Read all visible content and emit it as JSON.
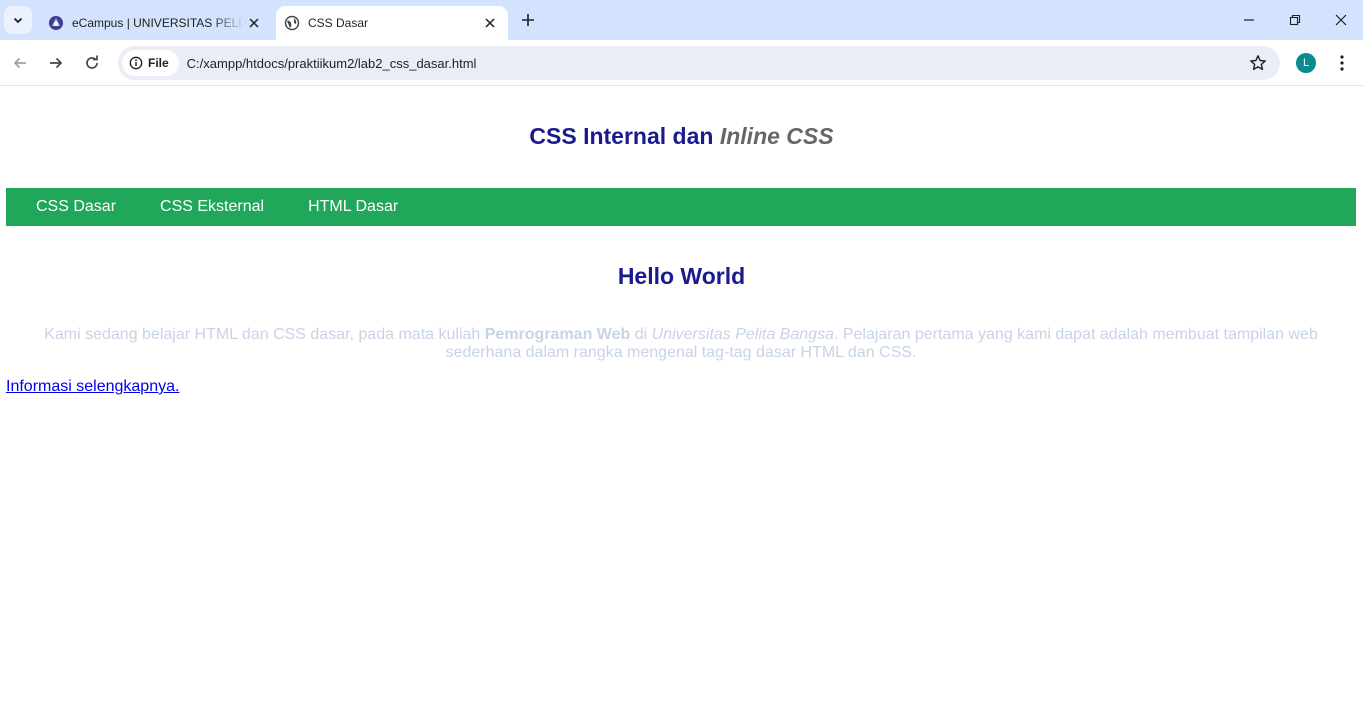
{
  "browser": {
    "tabs": [
      {
        "title": "eCampus | UNIVERSITAS PELITA BANGSA",
        "active": false,
        "favicon": "university-logo-icon"
      },
      {
        "title": "CSS Dasar",
        "active": true,
        "favicon": "globe-icon"
      }
    ],
    "address": {
      "chip_label": "File",
      "url": "C:/xampp/htdocs/praktiikum2/lab2_css_dasar.html"
    },
    "profile_initial": "L",
    "colors": {
      "tabbar": "#d3e3fd",
      "omnibox": "#e9eef6",
      "avatar": "#0b8a8f"
    }
  },
  "page": {
    "header": {
      "title_main": "CSS Internal dan ",
      "title_em": "Inline CSS"
    },
    "nav": {
      "items": [
        "CSS Dasar",
        "CSS Eksternal",
        "HTML Dasar"
      ],
      "color": "#21a75a"
    },
    "heading": "Hello World",
    "paragraph": {
      "part1": "Kami sedang belajar HTML dan CSS dasar, pada mata kuliah ",
      "bold": "Pemrograman Web",
      "part2": " di ",
      "italic": "Universitas Pelita Bangsa",
      "part3": ". Pelajaran pertama yang kami dapat adalah membuat tampilan web sederhana dalam rangka mengenal tag-tag dasar HTML dan CSS."
    },
    "link_text": "Informasi selengkapnya.",
    "colors": {
      "heading": "#1a1a8c",
      "paragraph": "#c8d3e6",
      "link": "#0000ee"
    }
  }
}
